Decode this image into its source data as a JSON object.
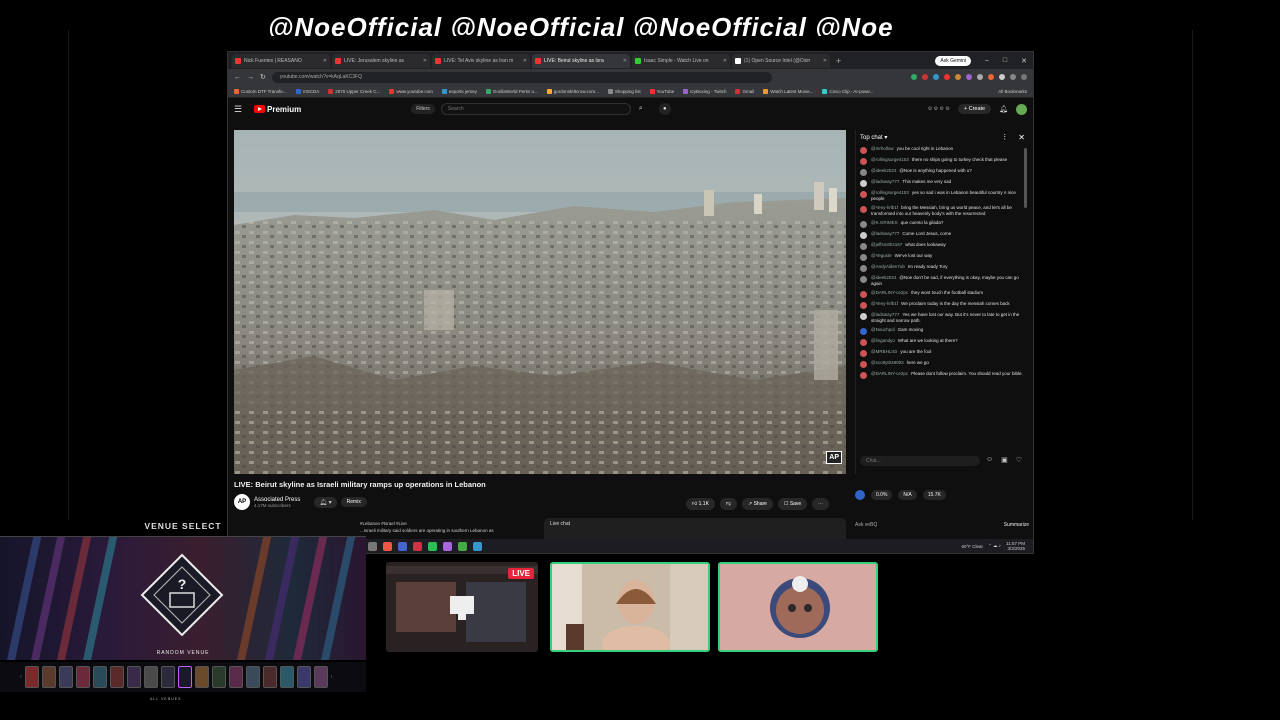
{
  "stream": {
    "banner_text": "@NoeOfficial @NoeOfficial @NoeOfficial @Noe"
  },
  "browser": {
    "tabs": [
      {
        "label": "Nick Fuentes | REASANO",
        "color": "#e33"
      },
      {
        "label": "LIVE: Jerusalem skyline as",
        "color": "#e33"
      },
      {
        "label": "LIVE: Tel Aviv skyline as Iran m",
        "color": "#e33"
      },
      {
        "label": "LIVE: Beirut skyline as Isra",
        "color": "#e33"
      },
      {
        "label": "Isaac Simple - Watch Live on",
        "color": "#3c3"
      },
      {
        "label": "(1) Open Source Intel (@Osin",
        "color": "#fff"
      }
    ],
    "gemini_label": "Ask Gemini",
    "url": "youtube.com/watch?v=kAqLaKC3FQ",
    "bookmarks": [
      "Custom DTF Transfe...",
      "VISCDA",
      "2870 Upper Creek C...",
      "www.youtube.com",
      "esports jersey",
      "GorillaWorld Perks o...",
      "gordonsfeltcrow.com...",
      "Shopping list",
      "YouTube",
      "IcyBoxing - Twitch",
      "Gmail",
      "Watch Latest Movie...",
      "Cisco Clip - AI-powe..."
    ],
    "all_bookmarks": "All Bookmarks"
  },
  "youtube": {
    "logo_text": "Premium",
    "filters_label": "Filters",
    "search_placeholder": "Search",
    "create_label": "Create",
    "video_title": "LIVE: Beirut skyline as Israeli military ramps up operations in Lebanon",
    "channel_name": "Associated Press",
    "channel_subs": "4.17M subscribers",
    "channel_avatar": "AP",
    "remix_label": "Remix",
    "like_label": "1.1K",
    "share_label": "Share",
    "save_label": "Save",
    "description": "#Lebanon #Israel #Live",
    "description_line2": "...Israeli military said soldiers are operating in southern Lebanon as",
    "live_chat_label": "Live chat",
    "watermark": "AP"
  },
  "chat": {
    "header": "Top chat",
    "messages": [
      {
        "user": "@mrhollow",
        "text": "you be cool right in Lebanon",
        "color": "#c55"
      },
      {
        "user": "@rollingsurge4153",
        "text": "there no ships going to turkey check that please",
        "color": "#c55"
      },
      {
        "user": "@ideek2024",
        "text": "@Noe is anything happened with u?",
        "color": "#888"
      },
      {
        "user": "@ladsway777",
        "text": "This makes me very sad",
        "color": "#ccc"
      },
      {
        "user": "@rollingsurge4153",
        "text": "yes so sad i was in Lebanon beautiful country n nice people",
        "color": "#c55"
      },
      {
        "user": "@Yeny-hrlb1f",
        "text": "bring the Messiah, bring us world peace, and let's all be transformed into our heavenly body's with the resurrected",
        "color": "#c55"
      },
      {
        "user": "@K.GRIMES",
        "text": "que cuento la gilada?",
        "color": "#888"
      },
      {
        "user": "@ladsway777",
        "text": "Come Lord Jesus, come",
        "color": "#ccc"
      },
      {
        "user": "@jeffsmith4167",
        "text": "what does lookaway",
        "color": "#888"
      },
      {
        "user": "@Yeguste",
        "text": "We've lost our way",
        "color": "#888"
      },
      {
        "user": "@AndyAlden7ub",
        "text": "Im ready ready Tory",
        "color": "#888"
      },
      {
        "user": "@ideek2024",
        "text": "@Noe don't be sad, if everything is okay, maybe you can go again",
        "color": "#888"
      },
      {
        "user": "@DARLINY-ce2pc",
        "text": "they wont touch the football stadium",
        "color": "#c55"
      },
      {
        "user": "@Yeny-hrlb1f",
        "text": "We proclaim today is the day the messiah comes back",
        "color": "#c55"
      },
      {
        "user": "@ladsway777",
        "text": "Yes we have lost our way. But it's never to late to get in the straight and narrow path.",
        "color": "#ccc"
      },
      {
        "user": "@Nouchpol",
        "text": "Gam moving",
        "color": "#36c"
      },
      {
        "user": "@lingandyo",
        "text": "What are we looking at there?",
        "color": "#c55"
      },
      {
        "user": "@MRBHLIGI",
        "text": "you are the fool",
        "color": "#c55"
      },
      {
        "user": "@scottyt048093",
        "text": "here we go",
        "color": "#c55"
      },
      {
        "user": "@DARLINY-ce2pc",
        "text": "Please dont follow proclaim. You should read your bible.",
        "color": "#c55"
      }
    ],
    "input_placeholder": "Chat...",
    "poll_values": [
      "0.0%",
      "N/A",
      "15.7K"
    ],
    "ask_label": "Ask veBQ",
    "summarize_label": "Summarize"
  },
  "taskbar": {
    "weather": "60°F Clear",
    "time": "11:57 PM",
    "date": "3/3/2026"
  },
  "venue": {
    "title": "VENUE SELECT",
    "random_label": "RANDOM VENUE",
    "all_venues": "ALL VENUES"
  },
  "cams": {
    "live_badge": "LIVE"
  }
}
